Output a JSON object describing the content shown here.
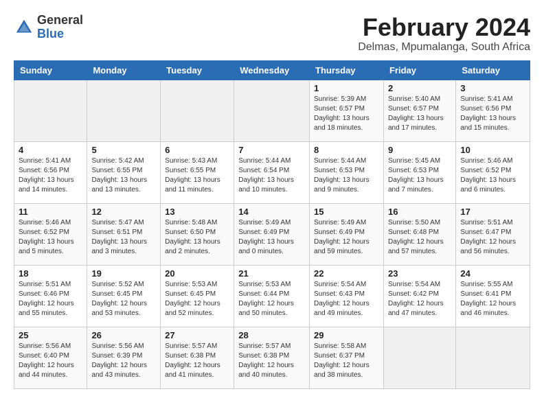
{
  "logo": {
    "general": "General",
    "blue": "Blue"
  },
  "header": {
    "title": "February 2024",
    "subtitle": "Delmas, Mpumalanga, South Africa"
  },
  "days_of_week": [
    "Sunday",
    "Monday",
    "Tuesday",
    "Wednesday",
    "Thursday",
    "Friday",
    "Saturday"
  ],
  "weeks": [
    [
      {
        "day": "",
        "info": ""
      },
      {
        "day": "",
        "info": ""
      },
      {
        "day": "",
        "info": ""
      },
      {
        "day": "",
        "info": ""
      },
      {
        "day": "1",
        "info": "Sunrise: 5:39 AM\nSunset: 6:57 PM\nDaylight: 13 hours\nand 18 minutes."
      },
      {
        "day": "2",
        "info": "Sunrise: 5:40 AM\nSunset: 6:57 PM\nDaylight: 13 hours\nand 17 minutes."
      },
      {
        "day": "3",
        "info": "Sunrise: 5:41 AM\nSunset: 6:56 PM\nDaylight: 13 hours\nand 15 minutes."
      }
    ],
    [
      {
        "day": "4",
        "info": "Sunrise: 5:41 AM\nSunset: 6:56 PM\nDaylight: 13 hours\nand 14 minutes."
      },
      {
        "day": "5",
        "info": "Sunrise: 5:42 AM\nSunset: 6:55 PM\nDaylight: 13 hours\nand 13 minutes."
      },
      {
        "day": "6",
        "info": "Sunrise: 5:43 AM\nSunset: 6:55 PM\nDaylight: 13 hours\nand 11 minutes."
      },
      {
        "day": "7",
        "info": "Sunrise: 5:44 AM\nSunset: 6:54 PM\nDaylight: 13 hours\nand 10 minutes."
      },
      {
        "day": "8",
        "info": "Sunrise: 5:44 AM\nSunset: 6:53 PM\nDaylight: 13 hours\nand 9 minutes."
      },
      {
        "day": "9",
        "info": "Sunrise: 5:45 AM\nSunset: 6:53 PM\nDaylight: 13 hours\nand 7 minutes."
      },
      {
        "day": "10",
        "info": "Sunrise: 5:46 AM\nSunset: 6:52 PM\nDaylight: 13 hours\nand 6 minutes."
      }
    ],
    [
      {
        "day": "11",
        "info": "Sunrise: 5:46 AM\nSunset: 6:52 PM\nDaylight: 13 hours\nand 5 minutes."
      },
      {
        "day": "12",
        "info": "Sunrise: 5:47 AM\nSunset: 6:51 PM\nDaylight: 13 hours\nand 3 minutes."
      },
      {
        "day": "13",
        "info": "Sunrise: 5:48 AM\nSunset: 6:50 PM\nDaylight: 13 hours\nand 2 minutes."
      },
      {
        "day": "14",
        "info": "Sunrise: 5:49 AM\nSunset: 6:49 PM\nDaylight: 13 hours\nand 0 minutes."
      },
      {
        "day": "15",
        "info": "Sunrise: 5:49 AM\nSunset: 6:49 PM\nDaylight: 12 hours\nand 59 minutes."
      },
      {
        "day": "16",
        "info": "Sunrise: 5:50 AM\nSunset: 6:48 PM\nDaylight: 12 hours\nand 57 minutes."
      },
      {
        "day": "17",
        "info": "Sunrise: 5:51 AM\nSunset: 6:47 PM\nDaylight: 12 hours\nand 56 minutes."
      }
    ],
    [
      {
        "day": "18",
        "info": "Sunrise: 5:51 AM\nSunset: 6:46 PM\nDaylight: 12 hours\nand 55 minutes."
      },
      {
        "day": "19",
        "info": "Sunrise: 5:52 AM\nSunset: 6:45 PM\nDaylight: 12 hours\nand 53 minutes."
      },
      {
        "day": "20",
        "info": "Sunrise: 5:53 AM\nSunset: 6:45 PM\nDaylight: 12 hours\nand 52 minutes."
      },
      {
        "day": "21",
        "info": "Sunrise: 5:53 AM\nSunset: 6:44 PM\nDaylight: 12 hours\nand 50 minutes."
      },
      {
        "day": "22",
        "info": "Sunrise: 5:54 AM\nSunset: 6:43 PM\nDaylight: 12 hours\nand 49 minutes."
      },
      {
        "day": "23",
        "info": "Sunrise: 5:54 AM\nSunset: 6:42 PM\nDaylight: 12 hours\nand 47 minutes."
      },
      {
        "day": "24",
        "info": "Sunrise: 5:55 AM\nSunset: 6:41 PM\nDaylight: 12 hours\nand 46 minutes."
      }
    ],
    [
      {
        "day": "25",
        "info": "Sunrise: 5:56 AM\nSunset: 6:40 PM\nDaylight: 12 hours\nand 44 minutes."
      },
      {
        "day": "26",
        "info": "Sunrise: 5:56 AM\nSunset: 6:39 PM\nDaylight: 12 hours\nand 43 minutes."
      },
      {
        "day": "27",
        "info": "Sunrise: 5:57 AM\nSunset: 6:38 PM\nDaylight: 12 hours\nand 41 minutes."
      },
      {
        "day": "28",
        "info": "Sunrise: 5:57 AM\nSunset: 6:38 PM\nDaylight: 12 hours\nand 40 minutes."
      },
      {
        "day": "29",
        "info": "Sunrise: 5:58 AM\nSunset: 6:37 PM\nDaylight: 12 hours\nand 38 minutes."
      },
      {
        "day": "",
        "info": ""
      },
      {
        "day": "",
        "info": ""
      }
    ]
  ]
}
